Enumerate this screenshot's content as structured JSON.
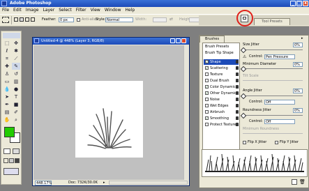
{
  "window": {
    "title": "Adobe Photoshop",
    "min": "_",
    "max": "□",
    "close": "x"
  },
  "menu": [
    "File",
    "Edit",
    "Image",
    "Layer",
    "Select",
    "Filter",
    "View",
    "Window",
    "Help"
  ],
  "options": {
    "feather_label": "Feather:",
    "feather_value": "0 px",
    "antialias_label": "Anti-alias",
    "style_label": "Style:",
    "style_value": "Normal",
    "width_label": "Width:",
    "height_label": "Height:",
    "tool_presets_tab": "Tool Presets"
  },
  "document": {
    "title": "Untitled-4 @ 448% (Layer 3, RGB/8)",
    "zoom": "448.17%",
    "doc_info": "Doc: 732K/30.0K"
  },
  "brushes": {
    "tab": "Brushes",
    "items": [
      {
        "label": "Brush Presets",
        "check": false,
        "lock": false
      },
      {
        "label": "Brush Tip Shape",
        "check": false,
        "lock": false
      },
      {
        "label": "Shape Dynamics",
        "check": true,
        "lock": true
      },
      {
        "label": "Scattering",
        "check": true,
        "lock": true
      },
      {
        "label": "Texture",
        "check": false,
        "lock": true
      },
      {
        "label": "Dual Brush",
        "check": false,
        "lock": true
      },
      {
        "label": "Color Dynamics",
        "check": true,
        "lock": true
      },
      {
        "label": "Other Dynamics",
        "check": true,
        "lock": true
      },
      {
        "label": "Noise",
        "check": false,
        "lock": true
      },
      {
        "label": "Wet Edges",
        "check": false,
        "lock": true
      },
      {
        "label": "Airbrush",
        "check": false,
        "lock": true
      },
      {
        "label": "Smoothing",
        "check": true,
        "lock": true
      },
      {
        "label": "Protect Texture",
        "check": false,
        "lock": true
      }
    ],
    "size_jitter_label": "Size Jitter",
    "size_jitter_value": "0%",
    "control_label": "Control:",
    "control1_value": "Pen Pressure",
    "min_diameter_label": "Minimum Diameter",
    "min_diameter_value": "0%",
    "tilt_scale_label": "Tilt Scale",
    "angle_jitter_label": "Angle Jitter",
    "angle_jitter_value": "0%",
    "control2_value": "Off",
    "roundness_jitter_label": "Roundness Jitter",
    "roundness_jitter_value": "0%",
    "control3_value": "Off",
    "min_roundness_label": "Minimum Roundness",
    "flip_x_label": "Flip X Jitter",
    "flip_y_label": "Flip Y Jitter"
  },
  "colors": {
    "foreground": "#22cc00",
    "background": "#ffffff",
    "accent": "#1d4bb8"
  }
}
